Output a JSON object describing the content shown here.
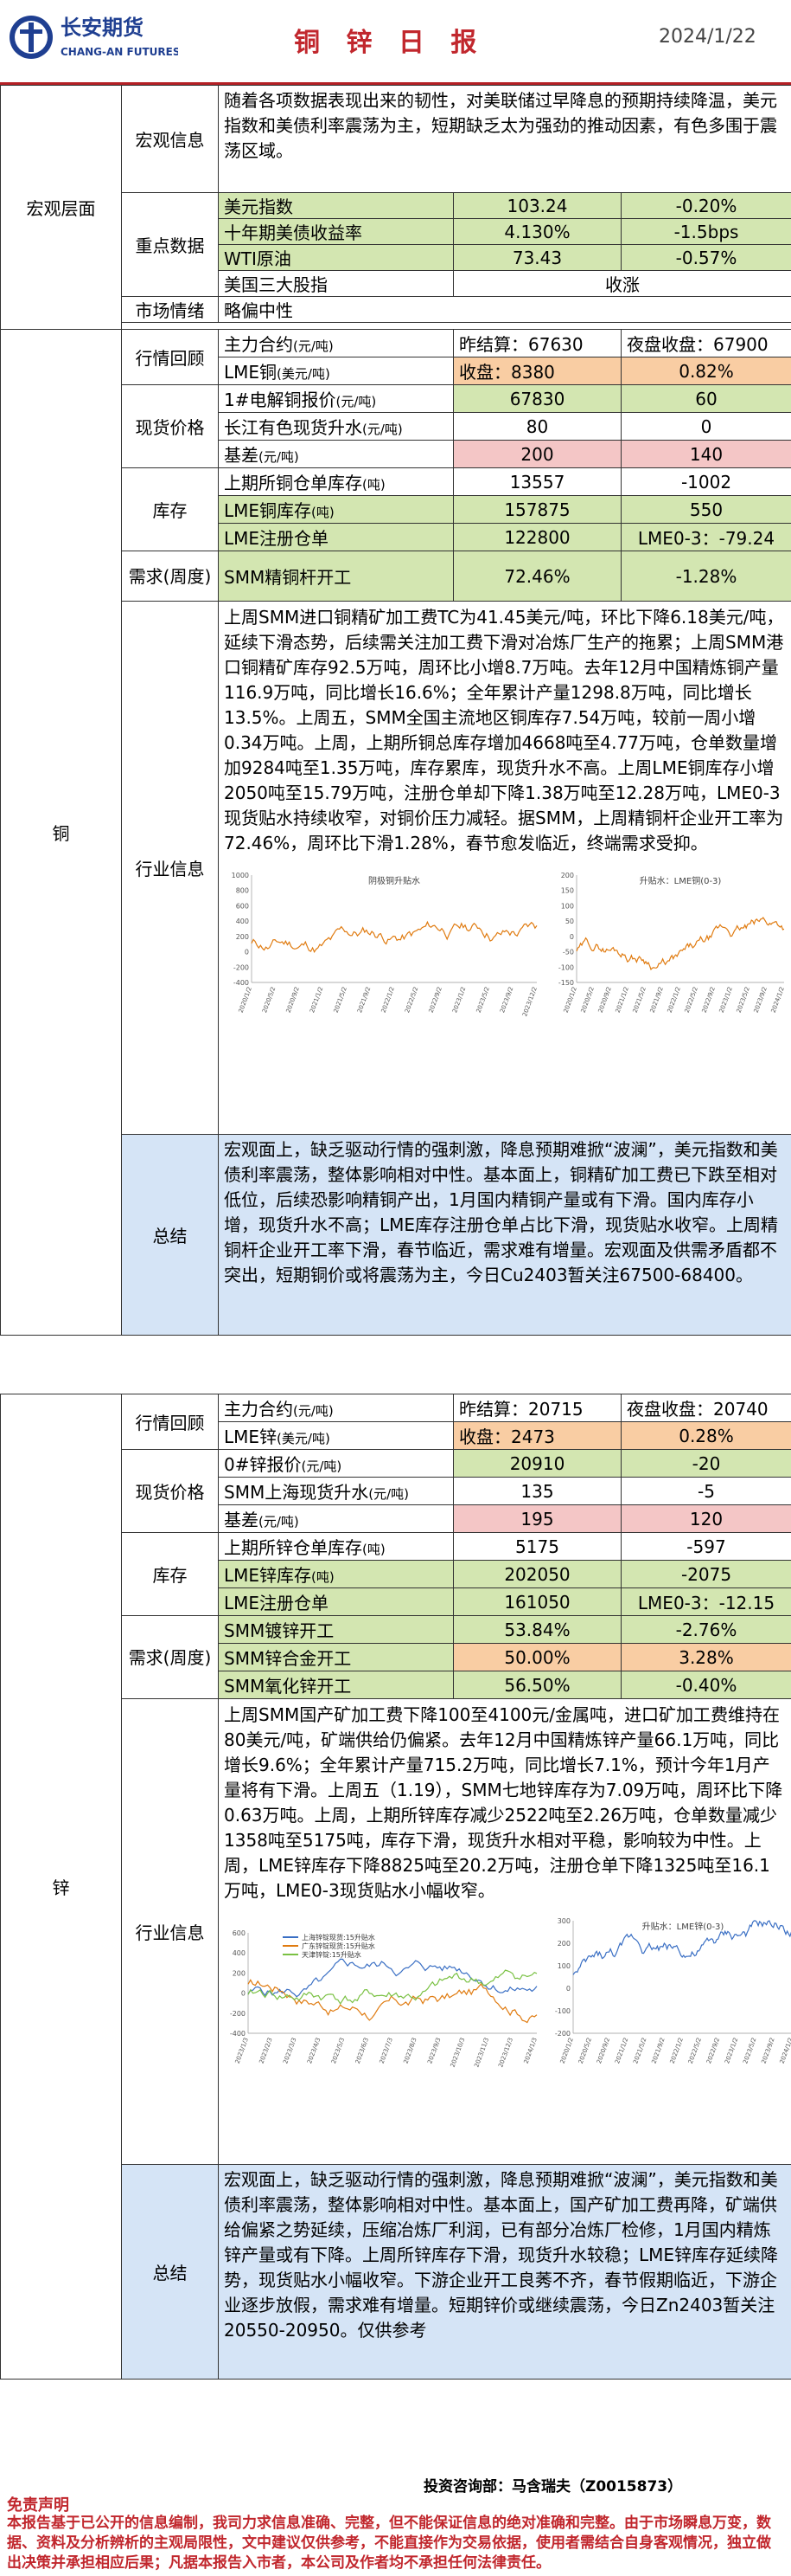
{
  "header": {
    "logo_cn": "长安期货",
    "logo_en": "CHANG-AN FUTURES",
    "title": "铜 锌 日 报",
    "date": "2024/1/22"
  },
  "macro": {
    "section": "宏观层面",
    "info_label": "宏观信息",
    "info_text": "随着各项数据表现出来的韧性，对美联储过早降息的预期持续降温，美元指数和美债利率震荡为主，短期缺乏太为强劲的推动因素，有色多围于震荡区域。",
    "key_label": "重点数据",
    "rows": [
      [
        "美元指数",
        "103.24",
        "-0.20%"
      ],
      [
        "十年期美债收益率",
        "4.130%",
        "-1.5bps"
      ],
      [
        "WTI原油",
        "73.43",
        "-0.57%"
      ],
      [
        "美国三大股指",
        "收涨"
      ]
    ],
    "sentiment_label": "市场情绪",
    "sentiment": "略偏中性"
  },
  "copper": {
    "section": "铜",
    "review_label": "行情回顾",
    "main_contract": "主力合约",
    "unit": "(元/吨)",
    "prev_close": "昨结算：67630",
    "night_close": "夜盘收盘：67900",
    "lme_label": "LME铜",
    "lme_unit": "(美元/吨)",
    "lme_close": "收盘：8380",
    "lme_chg": "0.82%",
    "spot_label": "现货价格",
    "spot_rows": [
      [
        "1#电解铜报价",
        "(元/吨)",
        "67830",
        "60"
      ],
      [
        "长江有色现货升水",
        "(元/吨)",
        "80",
        "0"
      ],
      [
        "基差",
        "(元/吨)",
        "200",
        "140"
      ]
    ],
    "stock_label": "库存",
    "stock_rows": [
      [
        "上期所铜仓单库存",
        "(吨)",
        "13557",
        "-1002"
      ],
      [
        "LME铜库存",
        "(吨)",
        "157875",
        "550"
      ],
      [
        "LME注册仓单",
        "",
        "122800",
        "LME0-3：-79.24"
      ]
    ],
    "demand_label": "需求(周度)",
    "demand_rows": [
      [
        "SMM精铜杆开工",
        "72.46%",
        "-1.28%"
      ]
    ],
    "industry_label": "行业信息",
    "industry_text": "上周SMM进口铜精矿加工费TC为41.45美元/吨，环比下降6.18美元/吨，延续下滑态势，后续需关注加工费下滑对冶炼厂生产的拖累；上周SMM港口铜精矿库存92.5万吨，周环比小增8.7万吨。去年12月中国精炼铜产量116.9万吨，同比增长16.6%；全年累计产量1298.8万吨，同比增长13.5%。上周五，SMM全国主流地区铜库存7.54万吨，较前一周小增0.34万吨。上周，上期所铜总库存增加4668吨至4.77万吨，仓单数量增加9284吨至1.35万吨，库存累库，现货升水不高。上周LME铜库存小增2050吨至15.79万吨，注册仓单却下降1.38万吨至12.28万吨，LME0-3现货贴水持续收窄，对铜价压力减轻。据SMM，上周精铜杆企业开工率为72.46%，周环比下滑1.28%，春节愈发临近，终端需求受抑。",
    "summary_label": "总结",
    "summary_text": "宏观面上，缺乏驱动行情的强刺激，降息预期难掀“波澜”，美元指数和美债利率震荡，整体影响相对中性。基本面上，铜精矿加工费已下跌至相对低位，后续恐影响精铜产出，1月国内精铜产量或有下滑。国内库存小增，现货升水不高；LME库存注册仓单占比下滑，现货贴水收窄。上周精铜杆企业开工率下滑，春节临近，需求难有增量。宏观面及供需矛盾都不突出，短期铜价或将震荡为主，今日Cu2403暂关注67500-68400。",
    "chart1": {
      "title": "阴极铜升贴水",
      "y_ticks": [
        "1000",
        "800",
        "600",
        "400",
        "200",
        "0",
        "-200",
        "-400"
      ],
      "x_ticks": [
        "2020/1/2",
        "2020/5/2",
        "2020/9/2",
        "2021/1/2",
        "2021/5/2",
        "2021/9/2",
        "2022/1/2",
        "2022/5/2",
        "2022/9/2",
        "2023/1/2",
        "2023/5/2",
        "2023/9/2",
        "2023/12/2"
      ],
      "color": "#e07b10"
    },
    "chart2": {
      "title": "升贴水：LME铜(0-3)",
      "y_ticks": [
        "200",
        "150",
        "100",
        "50",
        "0",
        "-50",
        "-100",
        "-150"
      ],
      "x_ticks": [
        "2020/1/2",
        "2020/5/2",
        "2020/9/2",
        "2021/1/2",
        "2021/5/2",
        "2021/9/2",
        "2022/1/2",
        "2022/5/2",
        "2022/9/2",
        "2023/1/2",
        "2023/5/2",
        "2023/9/2",
        "2024/1/2"
      ],
      "color": "#e07b10"
    }
  },
  "zinc": {
    "section": "锌",
    "review_label": "行情回顾",
    "main_contract": "主力合约",
    "unit": "(元/吨)",
    "prev_close": "昨结算：20715",
    "night_close": "夜盘收盘：20740",
    "lme_label": "LME锌",
    "lme_unit": "(美元/吨)",
    "lme_close": "收盘：2473",
    "lme_chg": "0.28%",
    "spot_label": "现货价格",
    "spot_rows": [
      [
        "0#锌报价",
        "(元/吨)",
        "20910",
        "-20"
      ],
      [
        "SMM上海现货升水",
        "(元/吨)",
        "135",
        "-5"
      ],
      [
        "基差",
        "(元/吨)",
        "195",
        "120"
      ]
    ],
    "stock_label": "库存",
    "stock_rows": [
      [
        "上期所锌仓单库存",
        "(吨)",
        "5175",
        "-597"
      ],
      [
        "LME锌库存",
        "(吨)",
        "202050",
        "-2075"
      ],
      [
        "LME注册仓单",
        "",
        "161050",
        "LME0-3：-12.15"
      ]
    ],
    "demand_label": "需求(周度)",
    "demand_rows": [
      [
        "SMM镀锌开工",
        "53.84%",
        "-2.76%"
      ],
      [
        "SMM锌合金开工",
        "50.00%",
        "3.28%"
      ],
      [
        "SMM氧化锌开工",
        "56.50%",
        "-0.40%"
      ]
    ],
    "industry_label": "行业信息",
    "industry_text": "上周SMM国产矿加工费下降100至4100元/金属吨，进口矿加工费维持在80美元/吨，矿端供给仍偏紧。去年12月中国精炼锌产量66.1万吨，同比增长9.6%；全年累计产量715.2万吨，同比增长7.1%，预计今年1月产量将有下滑。上周五（1.19），SMM七地锌库存为7.09万吨，周环比下降0.63万吨。上周，上期所锌库存减少2522吨至2.26万吨，仓单数量减少1358吨至5175吨，库存下滑，现货升水相对平稳，影响较为中性。上周，LME锌库存下降8825吨至20.2万吨，注册仓单下降1325吨至16.1万吨，LME0-3现货贴水小幅收窄。",
    "summary_label": "总结",
    "summary_text": "宏观面上，缺乏驱动行情的强刺激，降息预期难掀“波澜”，美元指数和美债利率震荡，整体影响相对中性。基本面上，国产矿加工费再降，矿端供给偏紧之势延续，压缩冶炼厂利润，已有部分冶炼厂检修，1月国内精炼锌产量或有下降。上周所锌库存下滑，现货升水较稳；LME锌库存延续降势，现货贴水小幅收窄。下游企业开工良莠不齐，春节假期临近，下游企业逐步放假，需求难有增量。短期锌价或继续震荡，今日Zn2403暂关注20550-20950。仅供参考",
    "chart1": {
      "legend": [
        "上海锌锭现货:15升贴水",
        "广东锌锭现货:15升贴水",
        "天津锌锭:15升贴水"
      ],
      "colors": [
        "#3a6fc4",
        "#e07b10",
        "#7ac143"
      ],
      "y_ticks": [
        "600",
        "400",
        "200",
        "0",
        "-200",
        "-400"
      ],
      "x_ticks": [
        "2023/1/3",
        "2023/2/3",
        "2023/3/3",
        "2023/4/3",
        "2023/5/3",
        "2023/6/3",
        "2023/7/3",
        "2023/8/3",
        "2023/9/3",
        "2023/10/3",
        "2023/11/3",
        "2023/12/3",
        "2024/1/3"
      ]
    },
    "chart2": {
      "title": "升贴水：LME锌(0-3)",
      "y_ticks": [
        "300",
        "200",
        "100",
        "0",
        "-100",
        "-200"
      ],
      "x_ticks": [
        "2020/1/2",
        "2020/5/2",
        "2020/9/2",
        "2021/1/2",
        "2021/5/2",
        "2021/9/2",
        "2022/1/2",
        "2022/5/2",
        "2022/9/2",
        "2023/1/2",
        "2023/5/2",
        "2023/9/2",
        "2024/1/2"
      ],
      "color": "#3a6fc4"
    }
  },
  "footer": {
    "analyst": "投资咨询部：马含瑞夫（Z0015873）",
    "disclaimer_title": "免责声明",
    "disclaimer": "本报告基于已公开的信息编制，我司力求信息准确、完整，但不能保证信息的绝对准确和完整。由于市场瞬息万变，数据、资料及分析辨析的主观局限性，文中建议仅供参考，不能直接作为交易依据，使用者需结合自身客观情况，独立做出决策并承担相应后果；凡据本报告入市者，本公司及作者均不承担任何法律责任。"
  }
}
